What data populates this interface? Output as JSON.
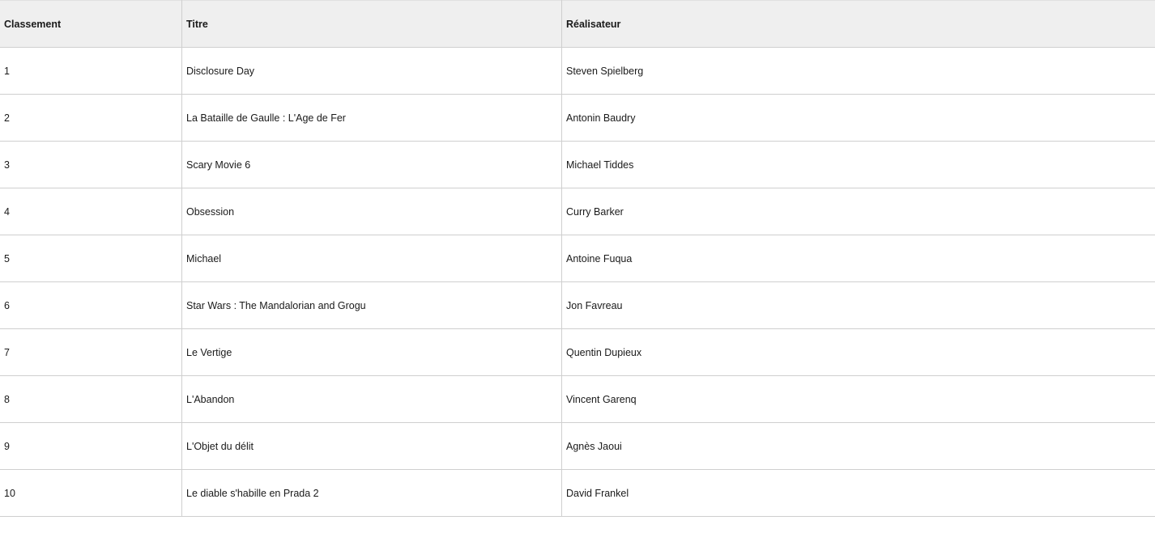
{
  "table": {
    "headers": [
      "Classement",
      "Titre",
      "Réalisateur"
    ],
    "rows": [
      {
        "rank": "1",
        "title": "Disclosure Day",
        "director": "Steven Spielberg"
      },
      {
        "rank": "2",
        "title": "La Bataille de Gaulle : L'Age de Fer",
        "director": "Antonin Baudry"
      },
      {
        "rank": "3",
        "title": "Scary Movie 6",
        "director": "Michael Tiddes"
      },
      {
        "rank": "4",
        "title": "Obsession",
        "director": "Curry Barker"
      },
      {
        "rank": "5",
        "title": "Michael",
        "director": "Antoine Fuqua"
      },
      {
        "rank": "6",
        "title": "Star Wars : The Mandalorian and Grogu",
        "director": "Jon Favreau"
      },
      {
        "rank": "7",
        "title": "Le Vertige",
        "director": "Quentin Dupieux"
      },
      {
        "rank": "8",
        "title": "L'Abandon",
        "director": "Vincent Garenq"
      },
      {
        "rank": "9",
        "title": "L'Objet du délit",
        "director": "Agnès Jaoui"
      },
      {
        "rank": "10",
        "title": "Le diable s'habille en Prada 2",
        "director": "David Frankel"
      }
    ]
  }
}
